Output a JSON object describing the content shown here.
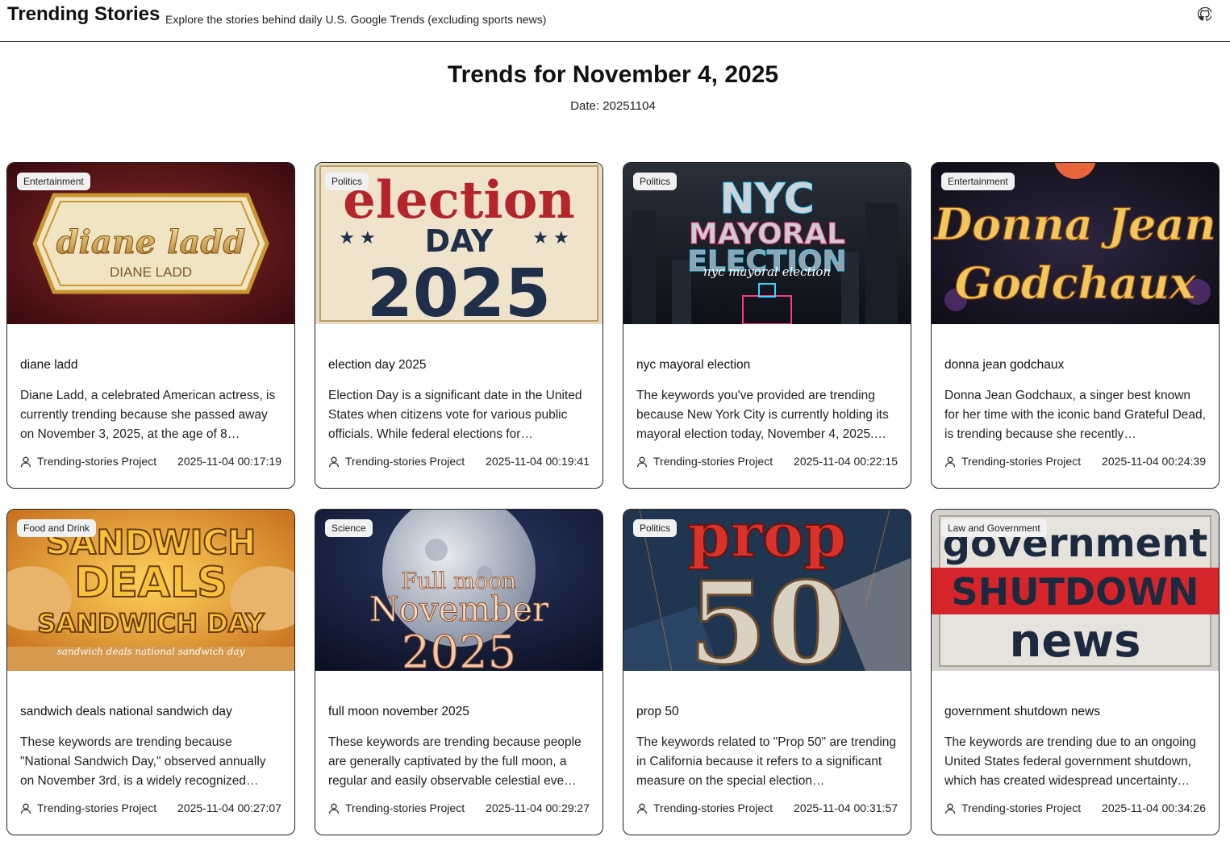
{
  "header": {
    "site_title": "Trending Stories",
    "site_subtitle": "Explore the stories behind daily U.S. Google Trends (excluding sports news)",
    "github_icon": "github-icon"
  },
  "main": {
    "heading": "Trends for November 4, 2025",
    "date_line": "Date: 20251104"
  },
  "cards": [
    {
      "category": "Entertainment",
      "image_text": [
        "diane ladd",
        "DIANE LADD"
      ],
      "title": "diane ladd",
      "description": "Diane Ladd, a celebrated American actress, is currently trending because she passed away on November 3, 2025, at the age of 8…",
      "author": "Trending-stories Project",
      "timestamp": "2025-11-04 00:17:19"
    },
    {
      "category": "Politics",
      "image_text": [
        "election",
        "DAY",
        "2025"
      ],
      "title": "election day 2025",
      "description": "Election Day is a significant date in the United States when citizens vote for various public officials. While federal elections for…",
      "author": "Trending-stories Project",
      "timestamp": "2025-11-04 00:19:41"
    },
    {
      "category": "Politics",
      "image_text": [
        "NYC",
        "MAYORAL",
        "ELECTION",
        "nyc mayoral election"
      ],
      "title": "nyc mayoral election",
      "description": "The keywords you've provided are trending because New York City is currently holding its mayoral election today, November 4, 2025.…",
      "author": "Trending-stories Project",
      "timestamp": "2025-11-04 00:22:15"
    },
    {
      "category": "Entertainment",
      "image_text": [
        "Donna Jean",
        "Godchaux"
      ],
      "title": "donna jean godchaux",
      "description": "Donna Jean Godchaux, a singer best known for her time with the iconic band Grateful Dead, is trending because she recently…",
      "author": "Trending-stories Project",
      "timestamp": "2025-11-04 00:24:39"
    },
    {
      "category": "Food and Drink",
      "image_text": [
        "SANDWICH",
        "DEALS",
        "SANDWICH DAY",
        "sandwich deals national sandwich day"
      ],
      "title": "sandwich deals national sandwich day",
      "description": "These keywords are trending because \"National Sandwich Day,\" observed annually on November 3rd, is a widely recognized…",
      "author": "Trending-stories Project",
      "timestamp": "2025-11-04 00:27:07"
    },
    {
      "category": "Science",
      "image_text": [
        "Full moon",
        "November",
        "2025"
      ],
      "title": "full moon november 2025",
      "description": "These keywords are trending because people are generally captivated by the full moon, a regular and easily observable celestial eve…",
      "author": "Trending-stories Project",
      "timestamp": "2025-11-04 00:29:27"
    },
    {
      "category": "Politics",
      "image_text": [
        "prop",
        "50"
      ],
      "title": "prop 50",
      "description": "The keywords related to \"Prop 50\" are trending in California because it refers to a significant measure on the special election…",
      "author": "Trending-stories Project",
      "timestamp": "2025-11-04 00:31:57"
    },
    {
      "category": "Law and Government",
      "image_text": [
        "government",
        "SHUTDOWN",
        "news"
      ],
      "title": "government shutdown news",
      "description": "The keywords are trending due to an ongoing United States federal government shutdown, which has created widespread uncertainty…",
      "author": "Trending-stories Project",
      "timestamp": "2025-11-04 00:34:26"
    }
  ],
  "icons": {
    "author": "user-icon"
  },
  "colors": {
    "border": "#222222",
    "badge_bg": "#f1f1f1"
  }
}
